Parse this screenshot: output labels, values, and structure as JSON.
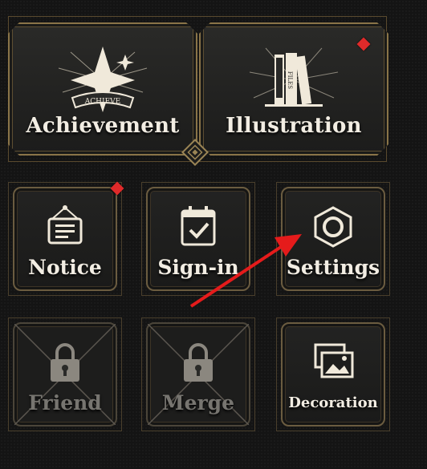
{
  "menu": {
    "achievement": {
      "label": "Achievement",
      "badge_text": "ACHIEVE"
    },
    "illustration": {
      "label": "Illustration",
      "book_text": "FILES",
      "has_alert": true
    },
    "notice": {
      "label": "Notice",
      "has_alert": true
    },
    "signin": {
      "label": "Sign-in"
    },
    "settings": {
      "label": "Settings"
    },
    "friend": {
      "label": "Friend",
      "locked": true
    },
    "merge": {
      "label": "Merge",
      "locked": true
    },
    "decoration": {
      "label": "Decoration"
    }
  },
  "colors": {
    "alert": "#e02a2a",
    "gold_frame": "#8a7448",
    "label": "#f2ede3",
    "locked_label": "#777570",
    "annotation_arrow": "#e51b1b"
  }
}
